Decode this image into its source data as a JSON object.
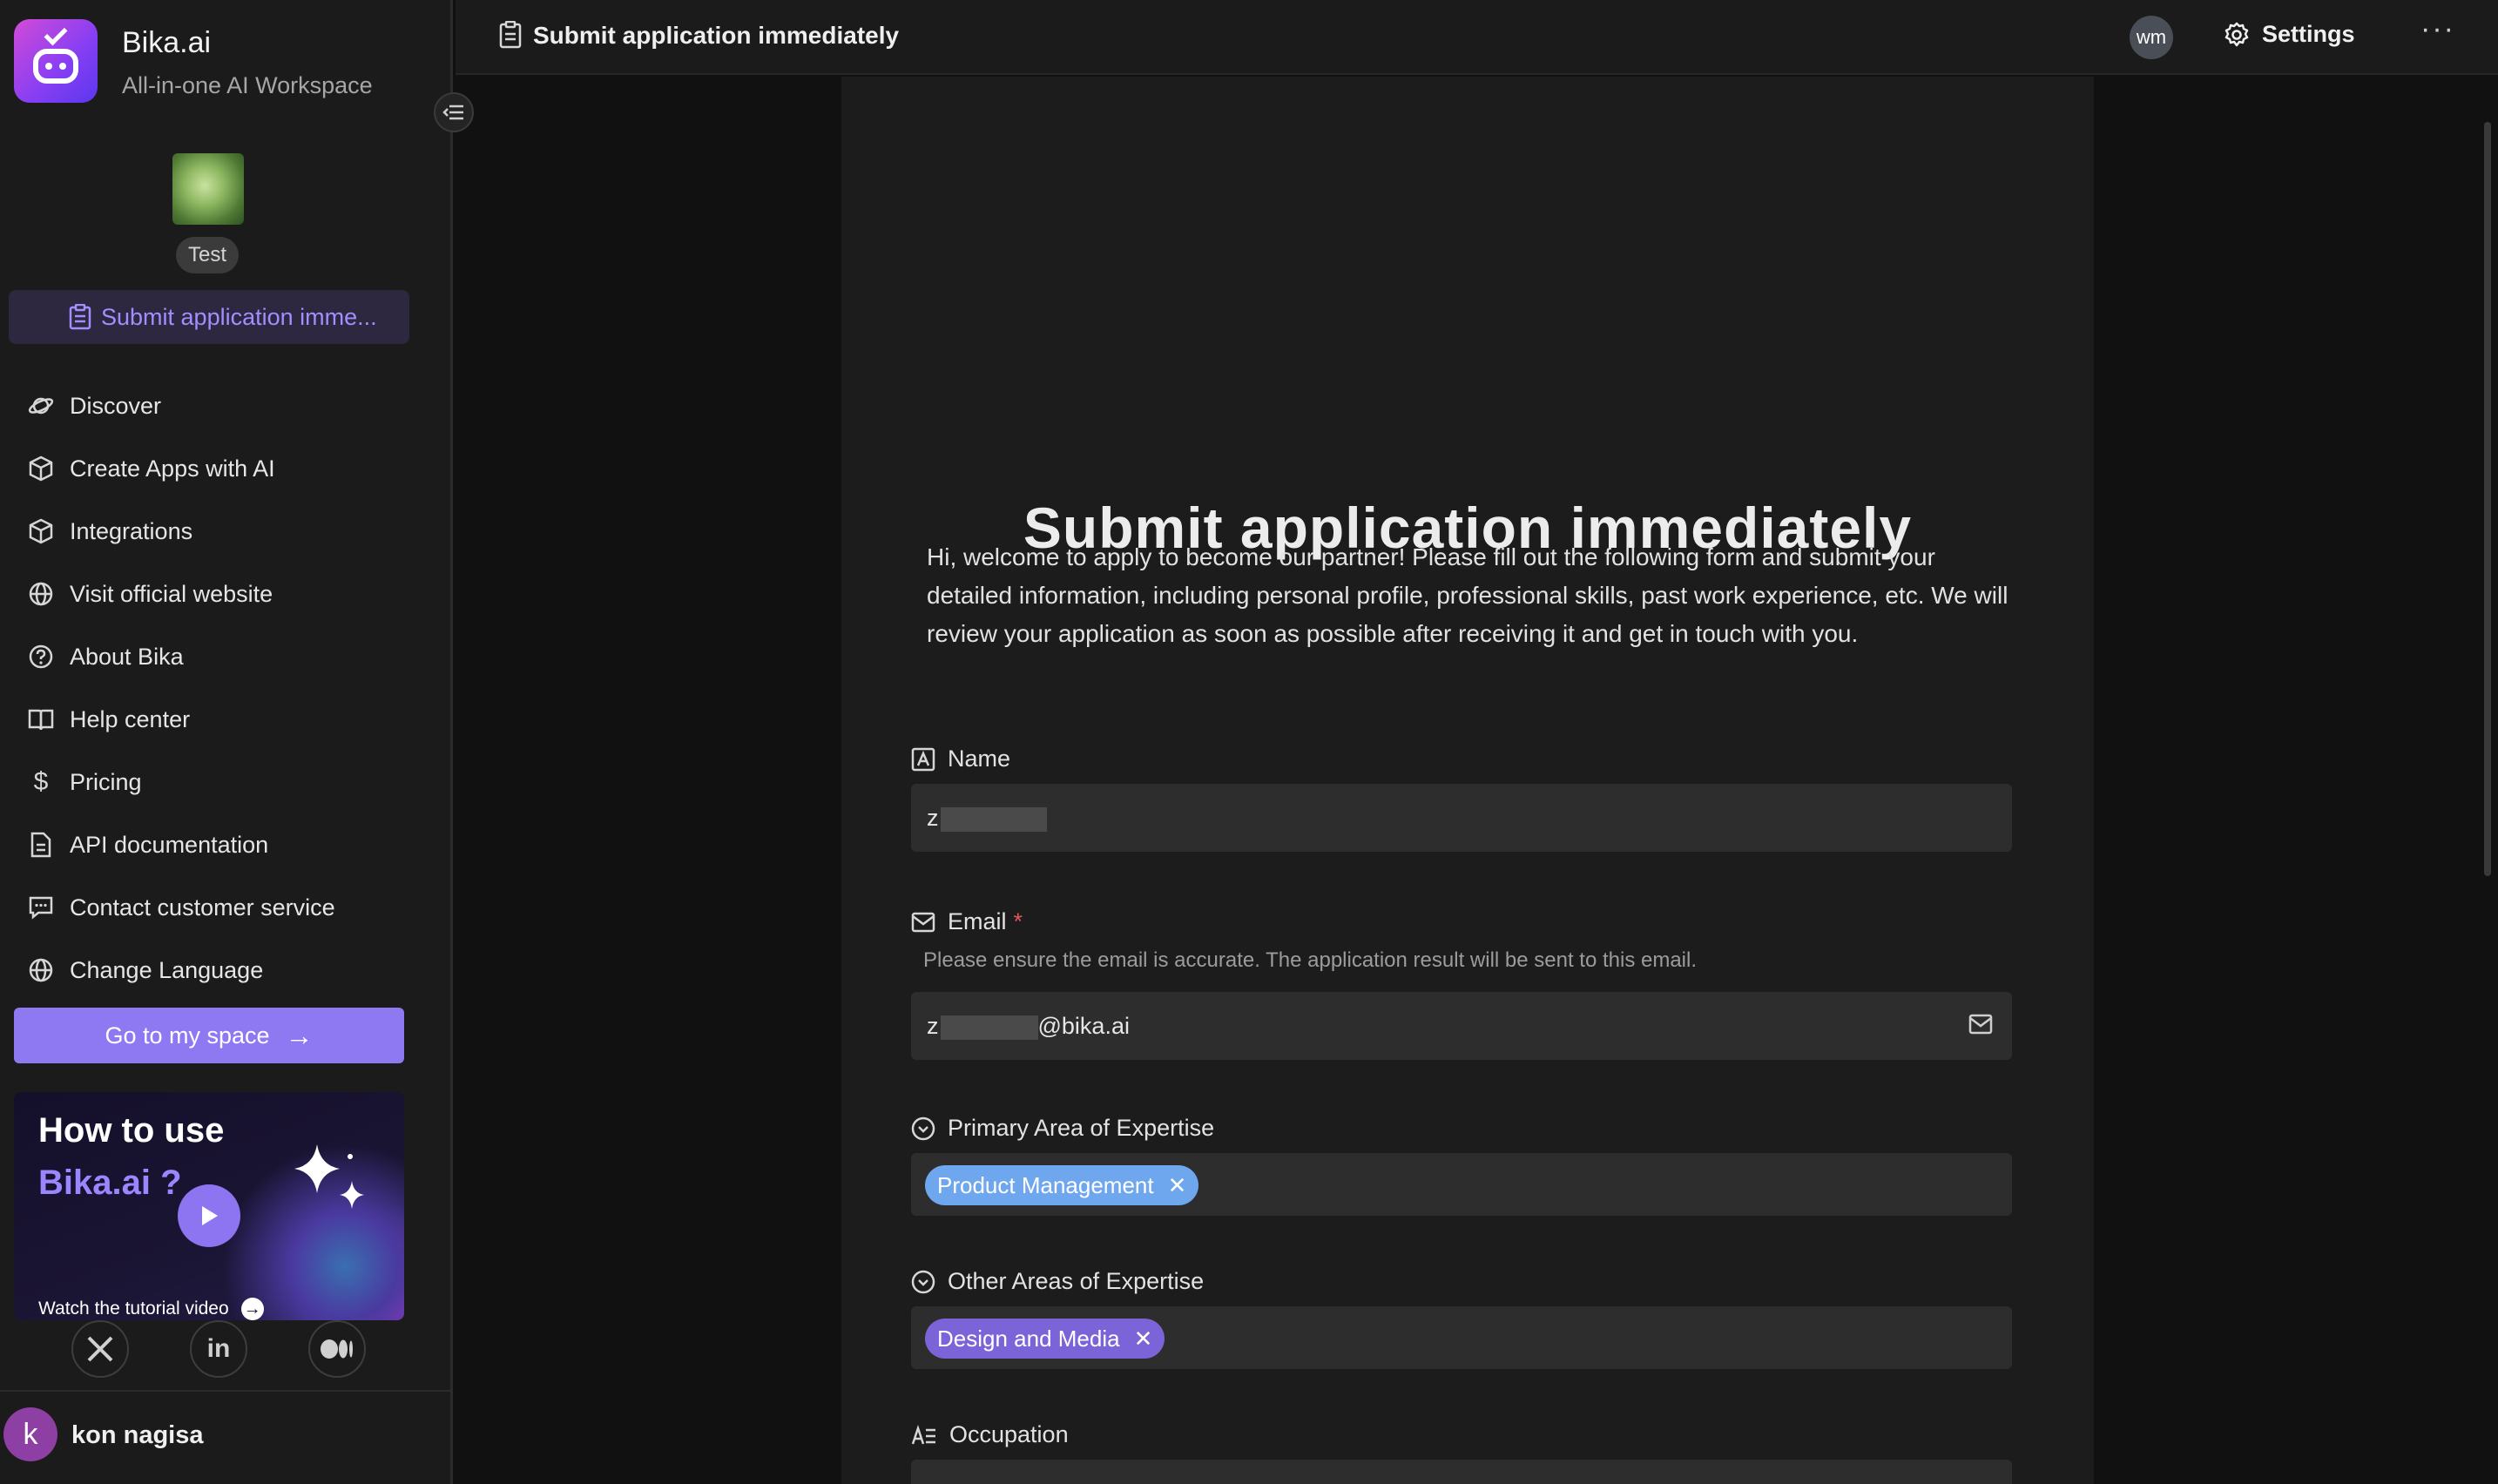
{
  "brand": {
    "name": "Bika.ai",
    "tagline": "All-in-one AI Workspace"
  },
  "space": {
    "label": "Test"
  },
  "sidebar": {
    "active_item": "Submit application imme...",
    "items": [
      {
        "label": "Discover",
        "icon": "planet-icon"
      },
      {
        "label": "Create Apps with AI",
        "icon": "cube-icon"
      },
      {
        "label": "Integrations",
        "icon": "cube-icon"
      },
      {
        "label": "Visit official website",
        "icon": "globe-icon"
      },
      {
        "label": "About Bika",
        "icon": "question-circle-icon"
      },
      {
        "label": "Help center",
        "icon": "book-icon"
      },
      {
        "label": "Pricing",
        "icon": "dollar-icon"
      },
      {
        "label": "API documentation",
        "icon": "document-icon"
      },
      {
        "label": "Contact customer service",
        "icon": "chat-icon"
      },
      {
        "label": "Change Language",
        "icon": "globe-icon"
      }
    ],
    "go_button": "Go to my space",
    "promo": {
      "line1": "How to use",
      "line2": "Bika.ai ?",
      "watch": "Watch the tutorial video"
    },
    "socials": [
      "x-icon",
      "linkedin-icon",
      "medium-icon"
    ],
    "user": {
      "initial": "k",
      "name": "kon nagisa"
    }
  },
  "topbar": {
    "title": "Submit application immediately",
    "avatar": "wm",
    "settings": "Settings",
    "more": "···"
  },
  "form": {
    "title": "Submit application immediately",
    "description": "Hi, welcome to apply to become our partner! Please fill out the following form and submit your detailed information, including personal profile, professional skills, past work experience, etc. We will review your application as soon as possible after receiving it and get in touch with you.",
    "fields": {
      "name": {
        "label": "Name",
        "value_prefix": "z"
      },
      "email": {
        "label": "Email",
        "required": "*",
        "hint": "Please ensure the email is accurate. The application result will be sent to this email.",
        "value_prefix": "z",
        "value_suffix": "@bika.ai"
      },
      "primary": {
        "label": "Primary Area of Expertise",
        "tag": "Product Management"
      },
      "other": {
        "label": "Other Areas of Expertise",
        "tag": "Design and Media"
      },
      "occupation": {
        "label": "Occupation"
      }
    }
  },
  "colors": {
    "accent": "#8f79f2",
    "tag_blue": "#6fa7ee",
    "tag_purple": "#7b64d8",
    "required": "#e2555b"
  }
}
